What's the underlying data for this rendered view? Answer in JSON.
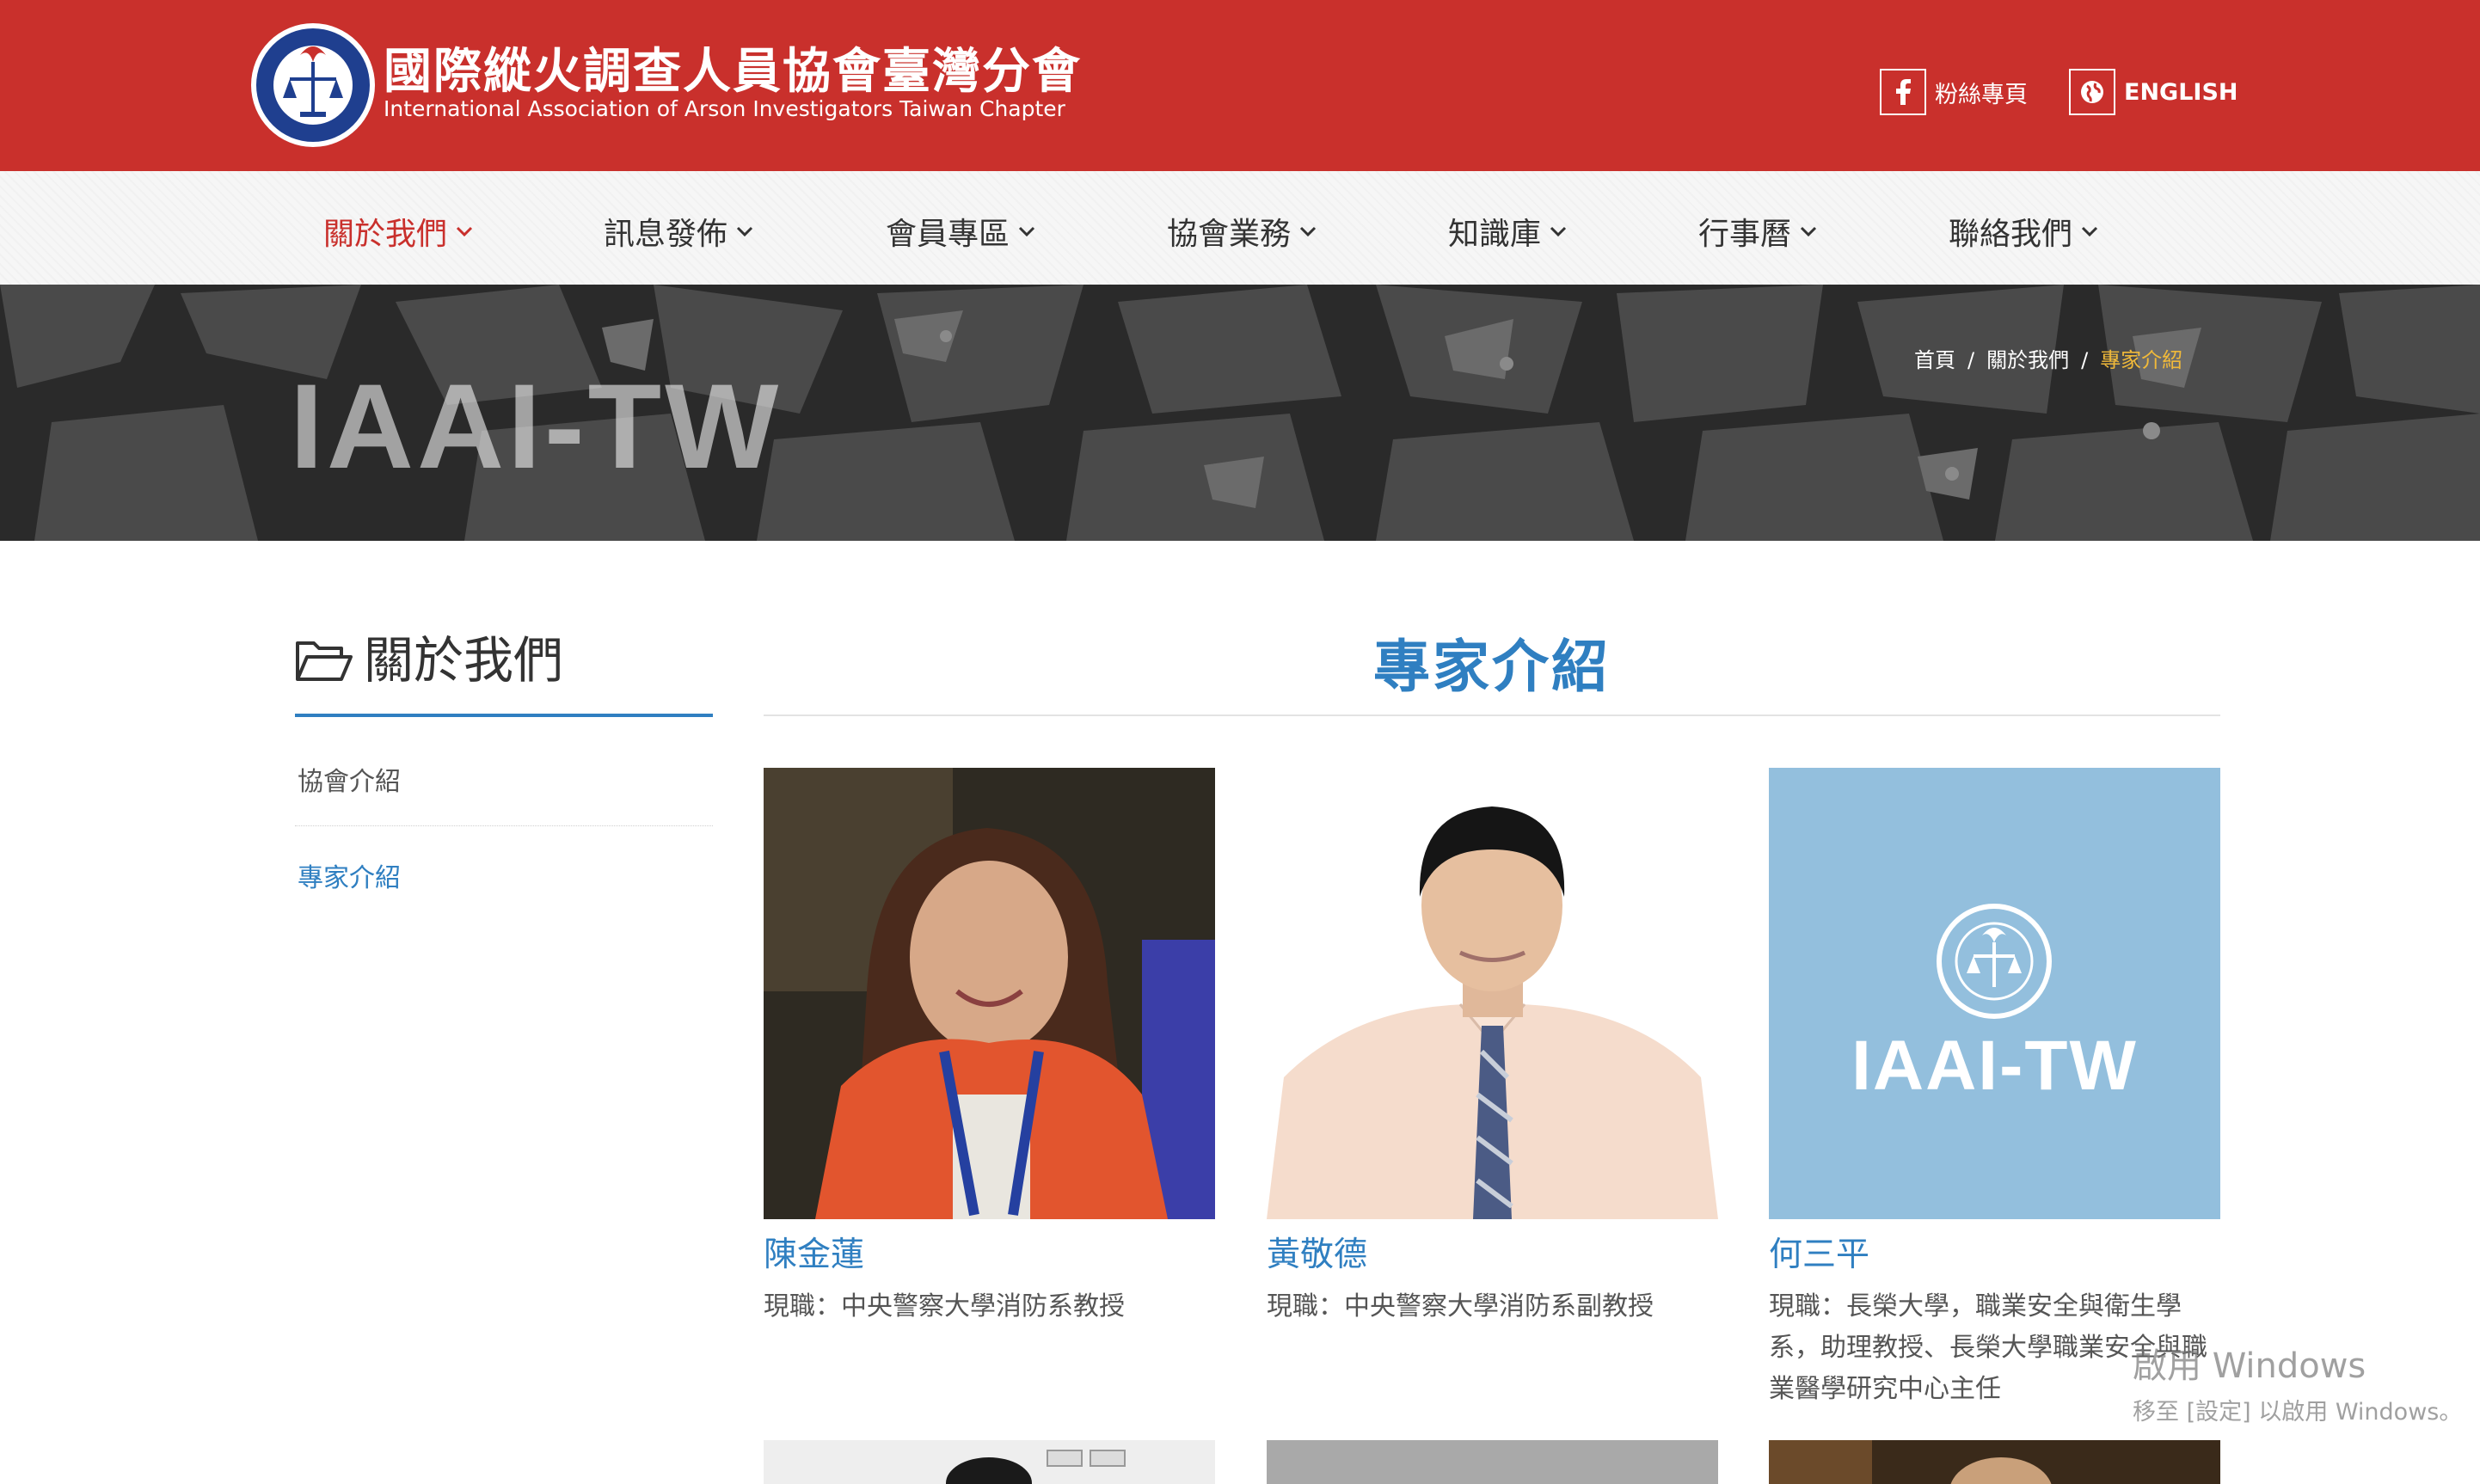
{
  "header": {
    "title_zh": "國際縱火調查人員協會臺灣分會",
    "title_en": "International Association of Arson Investigators Taiwan Chapter",
    "facebook_label": "粉絲專頁",
    "language_label": "ENGLISH",
    "accent_color": "#c9302c"
  },
  "nav": {
    "items": [
      {
        "label": "關於我們",
        "active": true
      },
      {
        "label": "訊息發佈"
      },
      {
        "label": "會員專區"
      },
      {
        "label": "協會業務"
      },
      {
        "label": "知識庫"
      },
      {
        "label": "行事曆"
      },
      {
        "label": "聯絡我們"
      }
    ]
  },
  "banner": {
    "title": "IAAI-TW",
    "breadcrumb": {
      "home": "首頁",
      "section": "關於我們",
      "current": "專家介紹",
      "separator": "/"
    }
  },
  "sidebar": {
    "heading": "關於我們",
    "links": [
      {
        "label": "協會介紹"
      },
      {
        "label": "專家介紹",
        "active": true
      }
    ]
  },
  "main": {
    "title": "專家介紹",
    "experts": [
      {
        "name": "陳金蓮",
        "job": "現職：中央警察大學消防系教授"
      },
      {
        "name": "黃敬德",
        "job": "現職：中央警察大學消防系副教授"
      },
      {
        "name": "何三平",
        "job": "現職：長榮大學，職業安全與衛生學系，助理教授、長榮大學職業安全與職業醫學研究中心主任",
        "placeholder_text": "IAAI-TW"
      }
    ]
  },
  "watermark": {
    "line1": "啟用 Windows",
    "line2": "移至 [設定] 以啟用 Windows。"
  },
  "colors": {
    "link_blue": "#2f7fc1",
    "breadcrumb_current": "#f0b93a",
    "placeholder_bg": "#93bfdd"
  }
}
